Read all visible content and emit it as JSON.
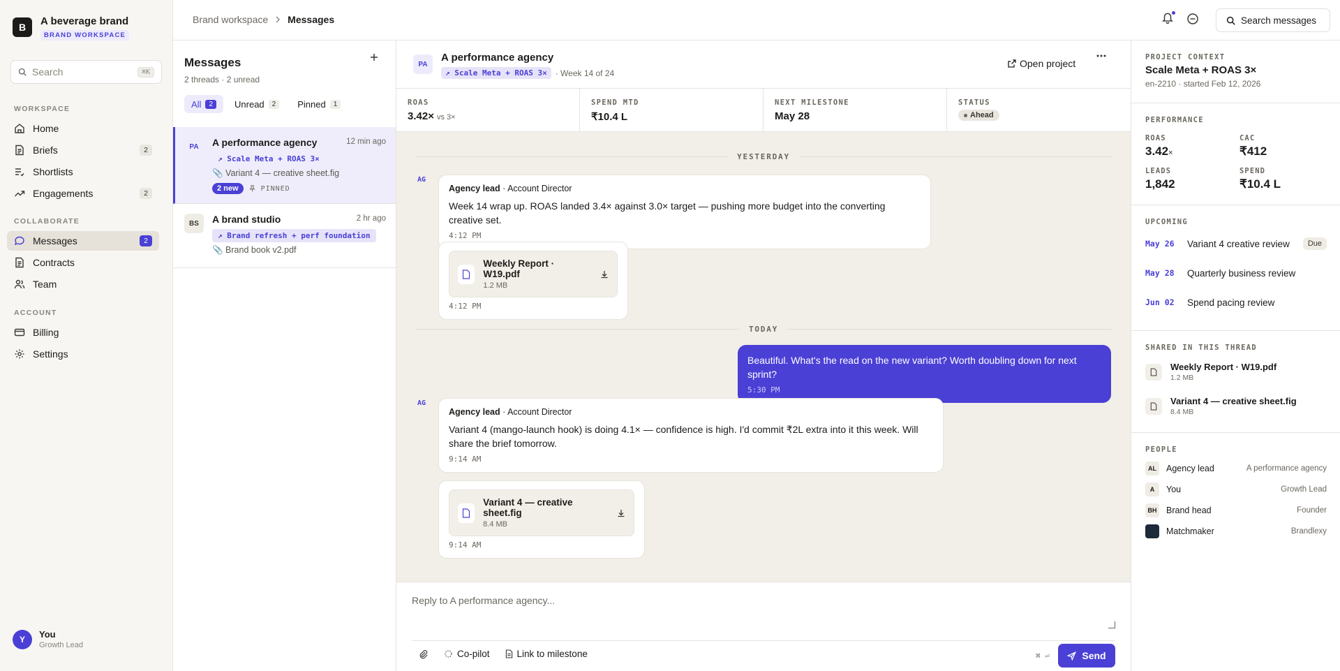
{
  "brand": {
    "logo": "B",
    "name": "A beverage brand",
    "tag": "BRAND WORKSPACE"
  },
  "sidebar": {
    "search_placeholder": "Search",
    "search_kbd": "⌘K",
    "sections": {
      "workspace": "WORKSPACE",
      "collaborate": "COLLABORATE",
      "account": "ACCOUNT"
    },
    "items": [
      {
        "label": "Home",
        "icon": "home-icon"
      },
      {
        "label": "Briefs",
        "icon": "document-icon",
        "count": "2"
      },
      {
        "label": "Shortlists",
        "icon": "list-check-icon"
      },
      {
        "label": "Engagements",
        "icon": "trend-icon",
        "count": "2"
      },
      {
        "label": "Messages",
        "icon": "chat-icon",
        "count": "2",
        "active": true
      },
      {
        "label": "Contracts",
        "icon": "document-icon"
      },
      {
        "label": "Team",
        "icon": "people-icon"
      },
      {
        "label": "Billing",
        "icon": "card-icon"
      },
      {
        "label": "Settings",
        "icon": "gear-icon"
      }
    ],
    "user": {
      "initial": "Y",
      "name": "You",
      "role": "Growth Lead"
    }
  },
  "header": {
    "breadcrumb_root": "Brand workspace",
    "breadcrumb_current": "Messages",
    "search_label": "Search messages"
  },
  "threads": {
    "title": "Messages",
    "subtitle": "2 threads · 2 unread",
    "filters": [
      {
        "label": "All",
        "count": "2"
      },
      {
        "label": "Unread",
        "count": "2"
      },
      {
        "label": "Pinned",
        "count": "1"
      }
    ],
    "items": [
      {
        "initials": "PA",
        "name": "A performance agency",
        "time": "12 min ago",
        "tag": "↗ Scale Meta + ROAS 3×",
        "file": "📎 Variant 4 — creative sheet.fig",
        "new_badge": "2 new",
        "pinned": "PINNED"
      },
      {
        "initials": "BS",
        "name": "A brand studio",
        "time": "2 hr ago",
        "tag": "↗ Brand refresh + perf foundation",
        "file": "📎 Brand book v2.pdf"
      }
    ]
  },
  "conversation": {
    "initials": "PA",
    "name": "A performance agency",
    "tag": "↗ Scale Meta + ROAS 3×",
    "week": "· Week 14 of 24",
    "open_project": "Open project",
    "stats": [
      {
        "label": "ROAS",
        "value": "3.42×",
        "note": "vs 3×"
      },
      {
        "label": "SPEND MTD",
        "value": "₹10.4 L"
      },
      {
        "label": "NEXT MILESTONE",
        "value": "May 28"
      },
      {
        "label": "STATUS",
        "value": "Ahead"
      }
    ],
    "day_yesterday": "YESTERDAY",
    "day_today": "TODAY",
    "messages": [
      {
        "avatar": "AG",
        "from": "Agency lead",
        "role": "· Account Director",
        "text": "Week 14 wrap up. ROAS landed 3.4× against 3.0× target — pushing more budget into the converting creative set.",
        "time": "4:12 PM"
      },
      {
        "attachment": "Weekly Report · W19.pdf",
        "size": "1.2 MB",
        "time": "4:12 PM"
      },
      {
        "mine": true,
        "text": "Beautiful. What's the read on the new variant? Worth doubling down for next sprint?",
        "time": "5:30 PM"
      },
      {
        "avatar": "AG",
        "from": "Agency lead",
        "role": "· Account Director",
        "text": "Variant 4 (mango-launch hook) is doing 4.1× — confidence is high. I'd commit ₹2L extra into it this week. Will share the brief tomorrow.",
        "time": "9:14 AM"
      },
      {
        "attachment": "Variant 4 — creative sheet.fig",
        "size": "8.4 MB",
        "time": "9:14 AM"
      }
    ],
    "composer": {
      "placeholder": "Reply to A performance agency...",
      "copilot": "Co-pilot",
      "link_milestone": "Link to milestone",
      "kbd": "⌘ ⏎",
      "send": "Send"
    }
  },
  "context": {
    "label": "PROJECT CONTEXT",
    "title": "Scale Meta + ROAS 3×",
    "sub": "en-2210 · started Feb 12, 2026",
    "performance_label": "PERFORMANCE",
    "performance": [
      {
        "label": "ROAS",
        "value": "3.42",
        "unit": "×"
      },
      {
        "label": "CAC",
        "value": "₹412"
      },
      {
        "label": "LEADS",
        "value": "1,842"
      },
      {
        "label": "SPEND",
        "value": "₹10.4 L"
      }
    ],
    "upcoming_label": "UPCOMING",
    "upcoming": [
      {
        "date": "May 26",
        "name": "Variant 4 creative review",
        "badge": "Due"
      },
      {
        "date": "May 28",
        "name": "Quarterly business review"
      },
      {
        "date": "Jun 02",
        "name": "Spend pacing review"
      }
    ],
    "shared_label": "SHARED IN THIS THREAD",
    "shared": [
      {
        "name": "Weekly Report · W19.pdf",
        "size": "1.2 MB"
      },
      {
        "name": "Variant 4 — creative sheet.fig",
        "size": "8.4 MB"
      }
    ],
    "people_label": "PEOPLE",
    "people": [
      {
        "initials": "AL",
        "name": "Agency lead",
        "org": "A performance agency"
      },
      {
        "initials": "A",
        "name": "You",
        "org": "Growth Lead"
      },
      {
        "initials": "BH",
        "name": "Brand head",
        "org": "Founder"
      },
      {
        "initials": "",
        "name": "Matchmaker",
        "org": "Brandlexy"
      }
    ]
  },
  "colors": {
    "accent": "#4a40d6",
    "canvas": "#f2efe8"
  }
}
